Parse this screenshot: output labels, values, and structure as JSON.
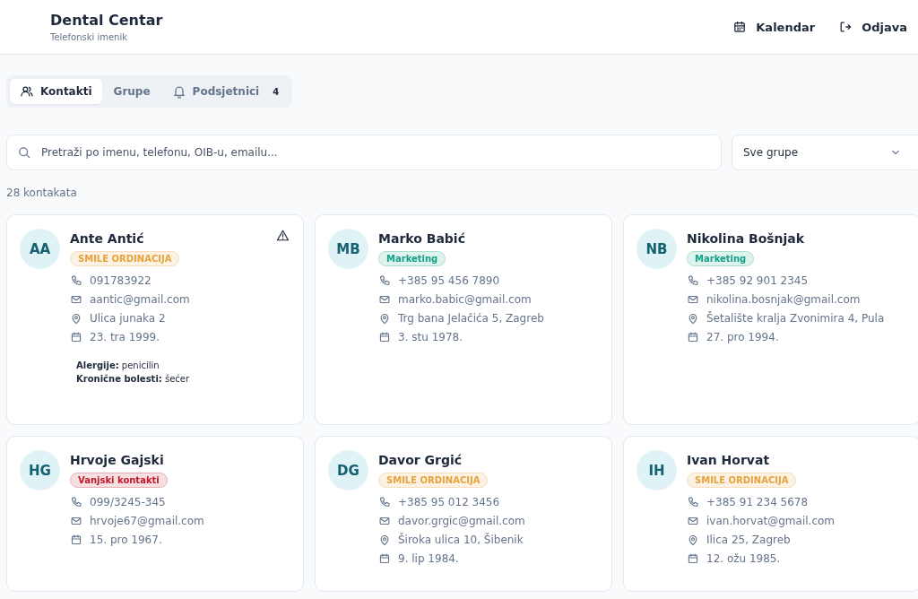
{
  "header": {
    "title": "Dental Centar",
    "subtitle": "Telefonski imenik",
    "actions": [
      {
        "kind": "calendar",
        "label": "Kalendar"
      },
      {
        "kind": "logout",
        "label": "Odjava"
      }
    ]
  },
  "tabs": [
    {
      "kind": "contacts",
      "label": "Kontakti",
      "selected": true
    },
    {
      "kind": "groups",
      "label": "Grupe",
      "selected": false
    },
    {
      "kind": "reminders",
      "label": "Podsjetnici",
      "selected": false,
      "count": "4"
    }
  ],
  "search": {
    "placeholder": "Pretraži po imenu, telefonu, OIB-u, emailu..."
  },
  "group_filter": {
    "value": "Sve grupe"
  },
  "count_text": "28 kontakata",
  "contacts": [
    {
      "initials": "AA",
      "name": "Ante Antić",
      "warning": true,
      "group": {
        "label": "SMILE ORDINACIJA",
        "color": "#e6a23c"
      },
      "details": [
        {
          "kind": "phone",
          "text": "091783922"
        },
        {
          "kind": "email",
          "text": "aantic@gmail.com"
        },
        {
          "kind": "address",
          "text": "Ulica junaka 2"
        },
        {
          "kind": "birthday",
          "text": "23. tra 1999."
        }
      ],
      "notes": [
        {
          "label": "Alergije:",
          "value": "penicilin"
        },
        {
          "label": "Kronične bolesti:",
          "value": "šećer"
        }
      ]
    },
    {
      "initials": "MB",
      "name": "Marko Babić",
      "warning": false,
      "group": {
        "label": "Marketing",
        "color": "#14a085"
      },
      "details": [
        {
          "kind": "phone",
          "text": "+385 95 456 7890"
        },
        {
          "kind": "email",
          "text": "marko.babic@gmail.com"
        },
        {
          "kind": "address",
          "text": "Trg bana Jelačića 5, Zagreb"
        },
        {
          "kind": "birthday",
          "text": "3. stu 1978."
        }
      ]
    },
    {
      "initials": "NB",
      "name": "Nikolina Bošnjak",
      "warning": false,
      "group": {
        "label": "Marketing",
        "color": "#14a085"
      },
      "details": [
        {
          "kind": "phone",
          "text": "+385 92 901 2345"
        },
        {
          "kind": "email",
          "text": "nikolina.bosnjak@gmail.com"
        },
        {
          "kind": "address",
          "text": "Šetalište kralja Zvonimira 4, Pula"
        },
        {
          "kind": "birthday",
          "text": "27. pro 1994."
        }
      ]
    },
    {
      "initials": "HG",
      "name": "Hrvoje Gajski",
      "warning": false,
      "group": {
        "label": "Vanjski kontakti",
        "color": "#c0182a"
      },
      "details": [
        {
          "kind": "phone",
          "text": "099/3245-345"
        },
        {
          "kind": "email",
          "text": "hrvoje67@gmail.com"
        },
        {
          "kind": "birthday",
          "text": "15. pro 1967."
        }
      ]
    },
    {
      "initials": "DG",
      "name": "Davor Grgić",
      "warning": false,
      "group": {
        "label": "SMILE ORDINACIJA",
        "color": "#e6a23c"
      },
      "details": [
        {
          "kind": "phone",
          "text": "+385 95 012 3456"
        },
        {
          "kind": "email",
          "text": "davor.grgic@gmail.com"
        },
        {
          "kind": "address",
          "text": "Široka ulica 10, Šibenik"
        },
        {
          "kind": "birthday",
          "text": "9. lip 1984."
        }
      ]
    },
    {
      "initials": "IH",
      "name": "Ivan Horvat",
      "warning": false,
      "group": {
        "label": "SMILE ORDINACIJA",
        "color": "#e6a23c"
      },
      "details": [
        {
          "kind": "phone",
          "text": "+385 91 234 5678"
        },
        {
          "kind": "email",
          "text": "ivan.horvat@gmail.com"
        },
        {
          "kind": "address",
          "text": "Ilica 25, Zagreb"
        },
        {
          "kind": "birthday",
          "text": "12. ožu 1985."
        }
      ]
    }
  ]
}
